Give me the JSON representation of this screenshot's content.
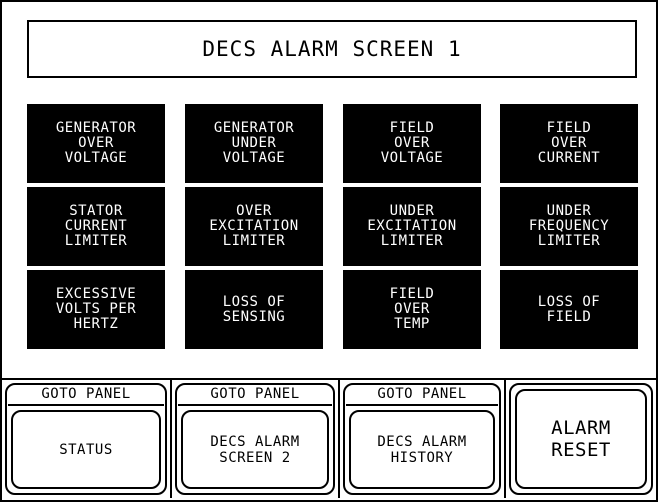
{
  "screen": {
    "title": "DECS ALARM SCREEN 1"
  },
  "alarms": [
    {
      "label": "GENERATOR\nOVER\nVOLTAGE"
    },
    {
      "label": "GENERATOR\nUNDER\nVOLTAGE"
    },
    {
      "label": "FIELD\nOVER\nVOLTAGE"
    },
    {
      "label": "FIELD\nOVER\nCURRENT"
    },
    {
      "label": "STATOR\nCURRENT\nLIMITER"
    },
    {
      "label": "OVER\nEXCITATION\nLIMITER"
    },
    {
      "label": "UNDER\nEXCITATION\nLIMITER"
    },
    {
      "label": "UNDER\nFREQUENCY\nLIMITER"
    },
    {
      "label": "EXCESSIVE\nVOLTS PER\nHERTZ"
    },
    {
      "label": "LOSS OF\nSENSING"
    },
    {
      "label": "FIELD\nOVER\nTEMP"
    },
    {
      "label": "LOSS OF\nFIELD"
    }
  ],
  "nav": [
    {
      "goto": "GOTO PANEL",
      "label": "STATUS"
    },
    {
      "goto": "GOTO PANEL",
      "label": "DECS ALARM\nSCREEN 2"
    },
    {
      "goto": "GOTO PANEL",
      "label": "DECS ALARM\nHISTORY"
    }
  ],
  "reset": {
    "label": "ALARM\nRESET"
  },
  "colors": {
    "alarm_background": "#000000",
    "alarm_text": "#ffffff",
    "background": "#ffffff"
  }
}
